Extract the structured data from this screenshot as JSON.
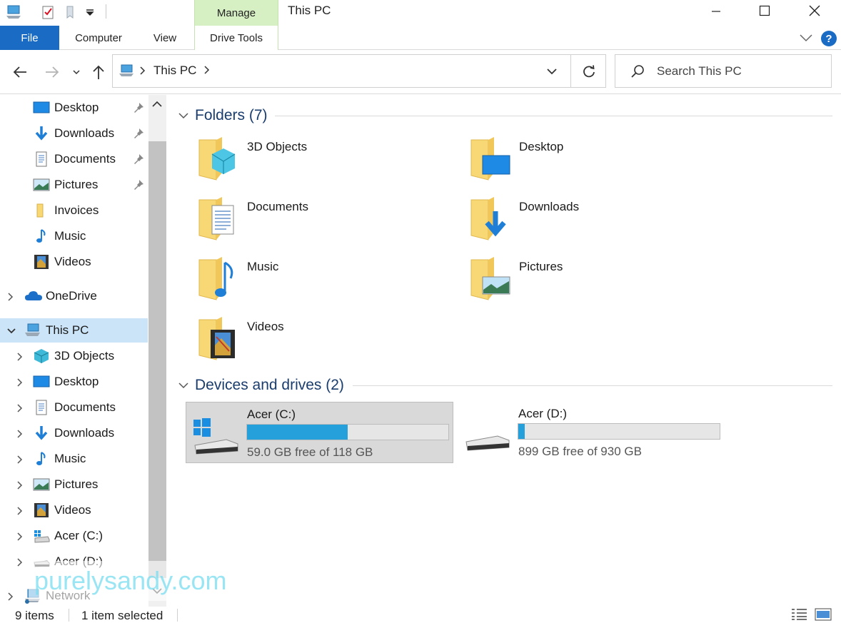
{
  "window": {
    "title": "This PC",
    "context_group": "Manage"
  },
  "ribbon": {
    "tabs": [
      {
        "label": "File"
      },
      {
        "label": "Computer"
      },
      {
        "label": "View"
      },
      {
        "label": "Drive Tools"
      }
    ],
    "help": "?"
  },
  "address": {
    "path": "This PC",
    "search_placeholder": "Search This PC"
  },
  "nav": {
    "quick_access": [
      {
        "label": "Desktop",
        "icon": "desktop-icon",
        "pinned": true
      },
      {
        "label": "Downloads",
        "icon": "downloads-icon",
        "pinned": true
      },
      {
        "label": "Documents",
        "icon": "documents-icon",
        "pinned": true
      },
      {
        "label": "Pictures",
        "icon": "pictures-icon",
        "pinned": true
      },
      {
        "label": "Invoices",
        "icon": "folder-icon",
        "pinned": false
      },
      {
        "label": "Music",
        "icon": "music-icon",
        "pinned": false
      },
      {
        "label": "Videos",
        "icon": "videos-icon",
        "pinned": false
      }
    ],
    "onedrive": "OneDrive",
    "this_pc": "This PC",
    "this_pc_children": [
      {
        "label": "3D Objects",
        "icon": "3d-objects-icon"
      },
      {
        "label": "Desktop",
        "icon": "desktop-icon"
      },
      {
        "label": "Documents",
        "icon": "documents-icon"
      },
      {
        "label": "Downloads",
        "icon": "downloads-icon"
      },
      {
        "label": "Music",
        "icon": "music-icon"
      },
      {
        "label": "Pictures",
        "icon": "pictures-icon"
      },
      {
        "label": "Videos",
        "icon": "videos-icon"
      },
      {
        "label": "Acer (C:)",
        "icon": "windows-drive-icon"
      },
      {
        "label": "Acer (D:)",
        "icon": "drive-icon"
      }
    ],
    "network": "Network"
  },
  "content": {
    "folders_header": "Folders (7)",
    "folders": [
      {
        "name": "3D Objects",
        "icon": "3d-objects-folder-icon"
      },
      {
        "name": "Desktop",
        "icon": "desktop-folder-icon"
      },
      {
        "name": "Documents",
        "icon": "documents-folder-icon"
      },
      {
        "name": "Downloads",
        "icon": "downloads-folder-icon"
      },
      {
        "name": "Music",
        "icon": "music-folder-icon"
      },
      {
        "name": "Pictures",
        "icon": "pictures-folder-icon"
      },
      {
        "name": "Videos",
        "icon": "videos-folder-icon"
      }
    ],
    "drives_header": "Devices and drives (2)",
    "drives": [
      {
        "name": "Acer (C:)",
        "free": "59.0 GB free of 118 GB",
        "used_fraction": 0.5,
        "selected": true,
        "icon": "windows-drive-icon"
      },
      {
        "name": "Acer (D:)",
        "free": "899 GB free of 930 GB",
        "used_fraction": 0.033,
        "selected": false,
        "icon": "drive-icon"
      }
    ]
  },
  "status": {
    "count": "9 items",
    "selection": "1 item selected"
  },
  "watermark": "purelysandy.com",
  "colors": {
    "accent": "#1a6bc4",
    "selection": "#cce4f7",
    "manage_context": "#d6f0c4",
    "drive_bar_fill": "#26a0da",
    "folder_yellow": "#f8d775"
  }
}
